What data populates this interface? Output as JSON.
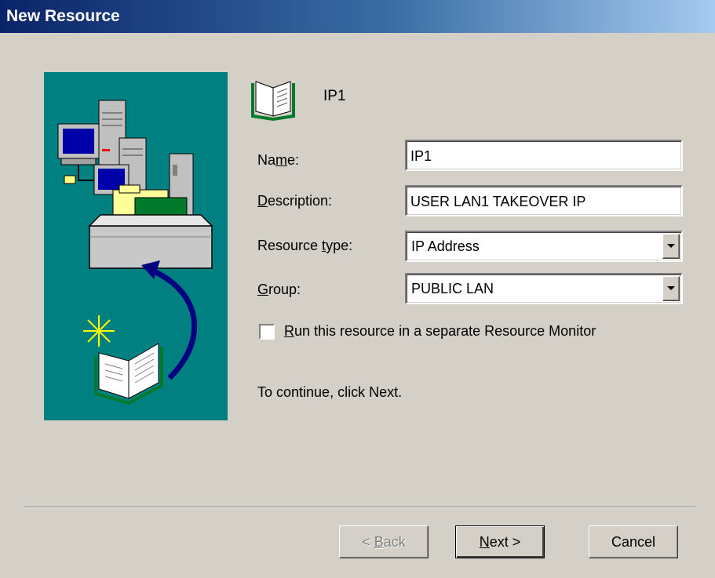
{
  "window": {
    "title": "New Resource"
  },
  "header": {
    "resource_name": "IP1",
    "icon": "open-book-icon"
  },
  "form": {
    "name": {
      "label_pre": "Na",
      "label_key": "m",
      "label_post": "e:",
      "value": "IP1"
    },
    "description": {
      "label_pre": "",
      "label_key": "D",
      "label_post": "escription:",
      "value": "USER LAN1 TAKEOVER IP"
    },
    "resource_type": {
      "label_pre": "Resource ",
      "label_key": "t",
      "label_post": "ype:",
      "value": "IP Address"
    },
    "group": {
      "label_pre": "",
      "label_key": "G",
      "label_post": "roup:",
      "value": "PUBLIC LAN"
    },
    "separate_monitor": {
      "label_pre": "",
      "label_key": "R",
      "label_post": "un this resource in a separate Resource Monitor",
      "checked": false
    }
  },
  "hint": "To continue, click Next.",
  "buttons": {
    "back": {
      "pre": "< ",
      "key": "B",
      "post": "ack",
      "enabled": false
    },
    "next": {
      "pre": "",
      "key": "N",
      "post": "ext >",
      "enabled": true
    },
    "cancel": {
      "label": "Cancel",
      "enabled": true
    }
  },
  "colors": {
    "titlebar": "#0a246a",
    "art_panel": "#008080",
    "face": "#d4d0c8"
  }
}
